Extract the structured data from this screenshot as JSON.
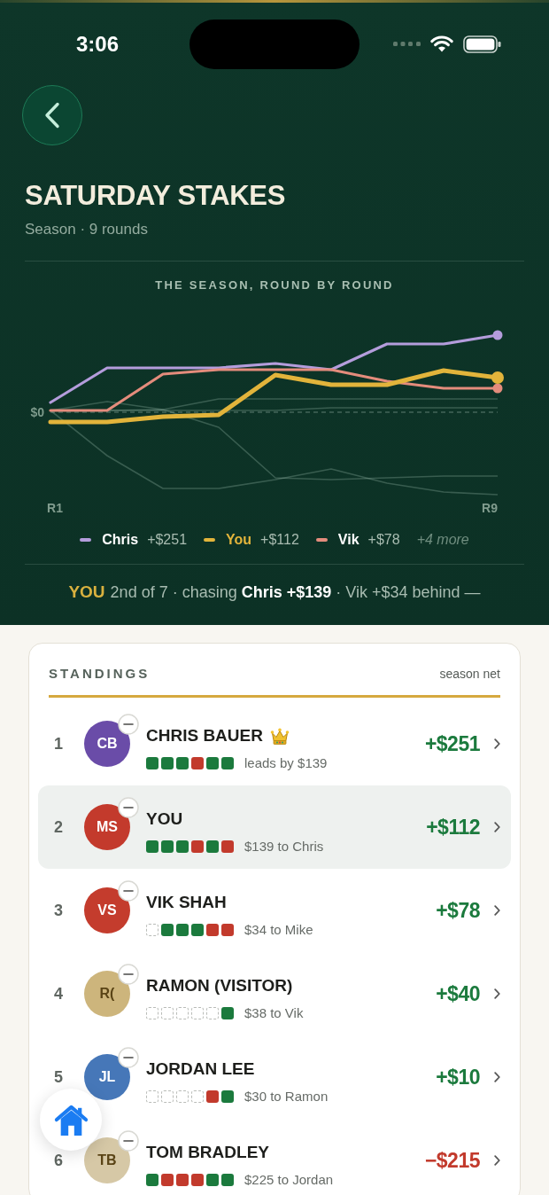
{
  "status_bar": {
    "time": "3:06"
  },
  "header": {
    "title": "SATURDAY STAKES",
    "subtitle": "Season · 9 rounds"
  },
  "chart": {
    "title": "THE SEASON, ROUND BY ROUND",
    "zero_label": "$0",
    "round_labels": [
      "R1",
      "R9"
    ],
    "legend": [
      {
        "name": "Chris",
        "value": "+$251",
        "color": "#b49ddc",
        "self": false
      },
      {
        "name": "You",
        "value": "+$112",
        "color": "#e2b43b",
        "self": true
      },
      {
        "name": "Vik",
        "value": "+$78",
        "color": "#e48c7c",
        "self": false
      }
    ],
    "more": "+4 more"
  },
  "summary": {
    "tag": "YOU",
    "text": "2nd of 7 · chasing **Chris +$139** · Vik +$34 behind —"
  },
  "standings": {
    "title": "STANDINGS",
    "column_label": "season net",
    "rows": [
      {
        "rank": "1",
        "initials": "CB",
        "color": "#6a4ca8",
        "name": "CHRIS BAUER",
        "crown": true,
        "form": [
          {
            "kind": "win"
          },
          {
            "kind": "win"
          },
          {
            "kind": "win"
          },
          {
            "kind": "loss"
          },
          {
            "kind": "win"
          },
          {
            "kind": "win"
          }
        ],
        "note": "leads by $139",
        "net": "+$251",
        "negative": false,
        "selected": false
      },
      {
        "rank": "2",
        "initials": "MS",
        "color": "#c33a2c",
        "name": "YOU",
        "crown": false,
        "form": [
          {
            "kind": "win"
          },
          {
            "kind": "win"
          },
          {
            "kind": "win"
          },
          {
            "kind": "loss"
          },
          {
            "kind": "win"
          },
          {
            "kind": "loss"
          }
        ],
        "note": "$139 to Chris",
        "net": "+$112",
        "negative": false,
        "selected": true
      },
      {
        "rank": "3",
        "initials": "VS",
        "color": "#c43c2d",
        "name": "VIK SHAH",
        "crown": false,
        "form": [
          {
            "kind": "none"
          },
          {
            "kind": "win"
          },
          {
            "kind": "win"
          },
          {
            "kind": "win"
          },
          {
            "kind": "loss"
          },
          {
            "kind": "loss"
          }
        ],
        "note": "$34 to Mike",
        "net": "+$78",
        "negative": false,
        "selected": false
      },
      {
        "rank": "4",
        "initials": "R(",
        "color": "#cdb57c",
        "name": "RAMON (VISITOR)",
        "crown": false,
        "form": [
          {
            "kind": "none"
          },
          {
            "kind": "none"
          },
          {
            "kind": "none"
          },
          {
            "kind": "none"
          },
          {
            "kind": "none"
          },
          {
            "kind": "win"
          }
        ],
        "note": "$38 to Vik",
        "net": "+$40",
        "negative": false,
        "selected": false
      },
      {
        "rank": "5",
        "initials": "JL",
        "color": "#4677b8",
        "name": "JORDAN LEE",
        "crown": false,
        "form": [
          {
            "kind": "none"
          },
          {
            "kind": "none"
          },
          {
            "kind": "none"
          },
          {
            "kind": "none"
          },
          {
            "kind": "loss"
          },
          {
            "kind": "win"
          }
        ],
        "note": "$30 to Ramon",
        "net": "+$10",
        "negative": false,
        "selected": false
      },
      {
        "rank": "6",
        "initials": "TB",
        "color": "#d6c8a6",
        "name": "TOM BRADLEY",
        "crown": false,
        "form": [
          {
            "kind": "win"
          },
          {
            "kind": "loss"
          },
          {
            "kind": "loss"
          },
          {
            "kind": "loss"
          },
          {
            "kind": "win"
          },
          {
            "kind": "win"
          }
        ],
        "note": "$225 to Jordan",
        "net": "−$215",
        "negative": true,
        "selected": false
      }
    ]
  }
}
